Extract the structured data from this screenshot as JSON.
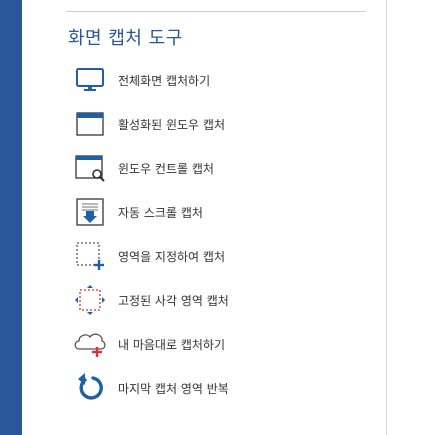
{
  "panel": {
    "title": "화면 캡처 도구",
    "items": [
      {
        "label": "전체화면 캡처하기",
        "icon": "monitor-icon"
      },
      {
        "label": "활성화된 윈도우 캡처",
        "icon": "window-icon"
      },
      {
        "label": "윈도우 컨트롤 캡처",
        "icon": "window-magnifier-icon"
      },
      {
        "label": "자동 스크롤 캡처",
        "icon": "scroll-capture-icon"
      },
      {
        "label": "영역을 지정하여 캡처",
        "icon": "region-select-icon"
      },
      {
        "label": "고정된 사각 영역 캡처",
        "icon": "fixed-rect-icon"
      },
      {
        "label": "내 마음대로 캡처하기",
        "icon": "freeform-cloud-icon"
      },
      {
        "label": "마지막 캡처 영역 반복",
        "icon": "repeat-icon"
      }
    ]
  },
  "colors": {
    "accent": "#2b579a",
    "icon_blue": "#1f5fa8",
    "icon_red": "#d9342b"
  }
}
